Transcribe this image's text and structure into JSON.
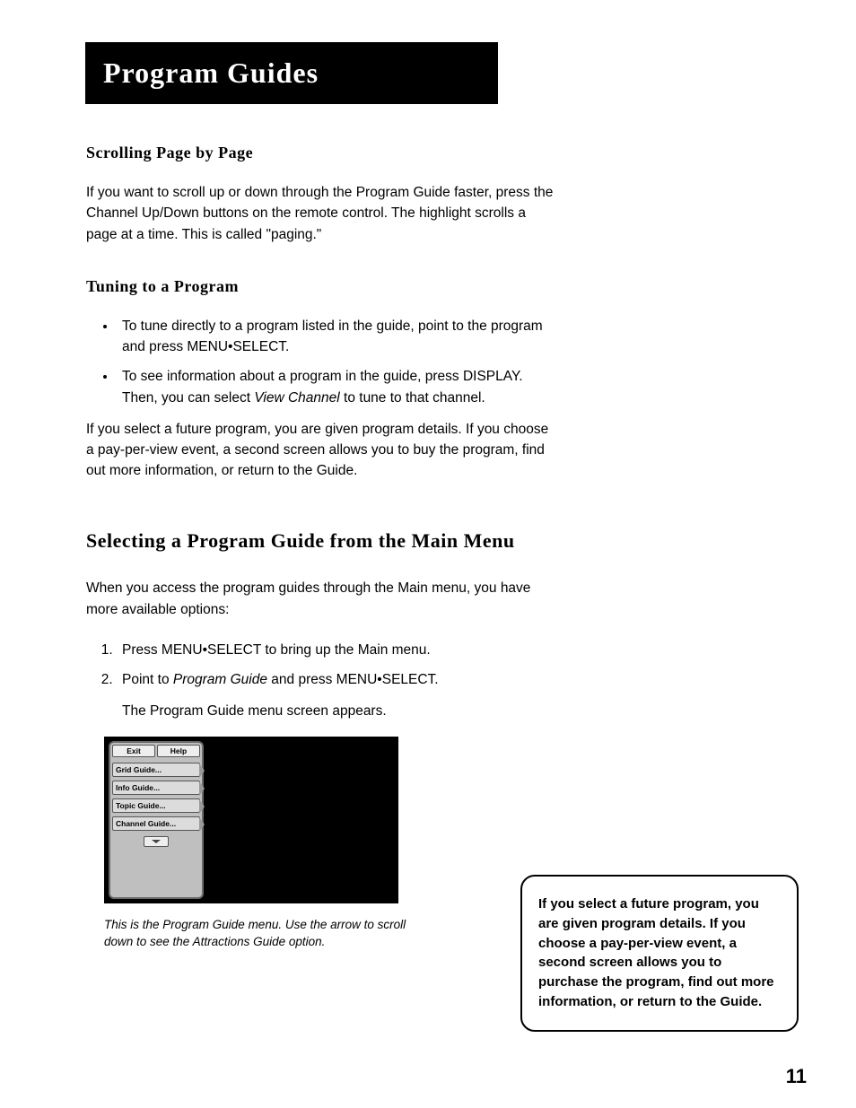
{
  "chapter_title": "Program Guides",
  "section1": {
    "heading": "Scrolling Page by Page",
    "p1": "If you want to scroll up or down through the Program Guide faster, press the Channel Up/Down buttons on the remote control. The highlight scrolls a page at a time. This is called \"paging.\""
  },
  "section2": {
    "heading": "Tuning to a Program",
    "bullet1": "To tune directly to a program listed in the guide, point to the program and press MENU•SELECT.",
    "bullet2_pre": "To see information about a program in the guide, press DISPLAY. Then, you can select ",
    "bullet2_em": "View Channel",
    "bullet2_post": " to tune to that channel.",
    "p_after": "If you select a future program, you are given program details. If you choose a pay-per-view event, a second screen allows you to buy the program, find out more information, or return to the Guide."
  },
  "section3": {
    "heading": "Selecting a Program Guide from the Main Menu",
    "intro": "When you access the program guides through the Main menu, you have more available options:",
    "step1": "Press MENU•SELECT to bring up the Main menu.",
    "step2_pre": "Point to ",
    "step2_em": "Program Guide",
    "step2_post": " and press MENU•SELECT.",
    "step2_result": "The Program Guide menu screen appears."
  },
  "menu_graphic": {
    "top_exit": "Exit",
    "top_help": "Help",
    "item1": "Grid Guide...",
    "item2": "Info Guide...",
    "item3": "Topic Guide...",
    "item4": "Channel Guide..."
  },
  "caption": "This is the Program Guide menu. Use the arrow to scroll down to see the Attractions Guide option.",
  "sidebar_note": "If you select a future program, you are given program details. If you choose a pay-per-view event, a second screen allows you to purchase the program, find out more information, or return to the Guide.",
  "page_number": "11"
}
